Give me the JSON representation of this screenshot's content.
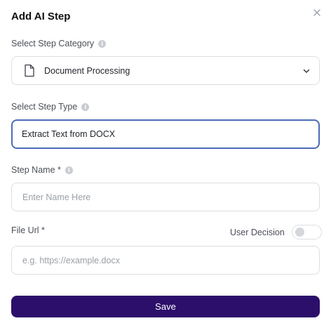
{
  "dialog": {
    "title": "Add AI Step",
    "close_icon": "close-icon"
  },
  "step_category": {
    "label": "Select Step Category",
    "value": "Document Processing",
    "icon": "document-icon"
  },
  "step_type": {
    "label": "Select Step Type",
    "value": "Extract Text from DOCX"
  },
  "step_name": {
    "label": "Step Name *",
    "placeholder": "Enter Name Here",
    "value": ""
  },
  "file_url": {
    "label": "File Url *",
    "placeholder": "e.g. https://example.docx",
    "value": ""
  },
  "user_decision": {
    "label": "User Decision",
    "enabled": false
  },
  "actions": {
    "save_label": "Save"
  },
  "colors": {
    "primary": "#2c0f6b",
    "focus_border": "#4b6cb7",
    "input_border": "#dcdee2"
  }
}
